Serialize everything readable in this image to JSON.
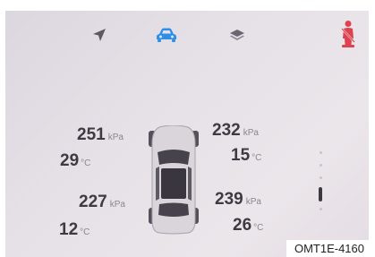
{
  "topbar": {
    "tabs": [
      {
        "name": "navigation",
        "icon": "navigation-arrow-icon",
        "active": false
      },
      {
        "name": "vehicle",
        "icon": "car-icon",
        "active": true
      },
      {
        "name": "layers",
        "icon": "layers-icon",
        "active": false
      }
    ],
    "alert_icon": "seatbelt-warning-icon"
  },
  "tires": {
    "front_left": {
      "pressure": "251",
      "pressure_unit": "kPa",
      "temperature": "29",
      "temperature_unit": "°C"
    },
    "front_right": {
      "pressure": "232",
      "pressure_unit": "kPa",
      "temperature": "15",
      "temperature_unit": "°C"
    },
    "rear_left": {
      "pressure": "227",
      "pressure_unit": "kPa",
      "temperature": "12",
      "temperature_unit": "°C"
    },
    "rear_right": {
      "pressure": "239",
      "pressure_unit": "kPa",
      "temperature": "26",
      "temperature_unit": "°C"
    }
  },
  "pager": {
    "pages": 5,
    "current": 4
  },
  "figure_code": "OMT1E-4160",
  "colors": {
    "accent": "#2e8fe8",
    "warning": "#e0414f",
    "text": "#3f3a42"
  }
}
